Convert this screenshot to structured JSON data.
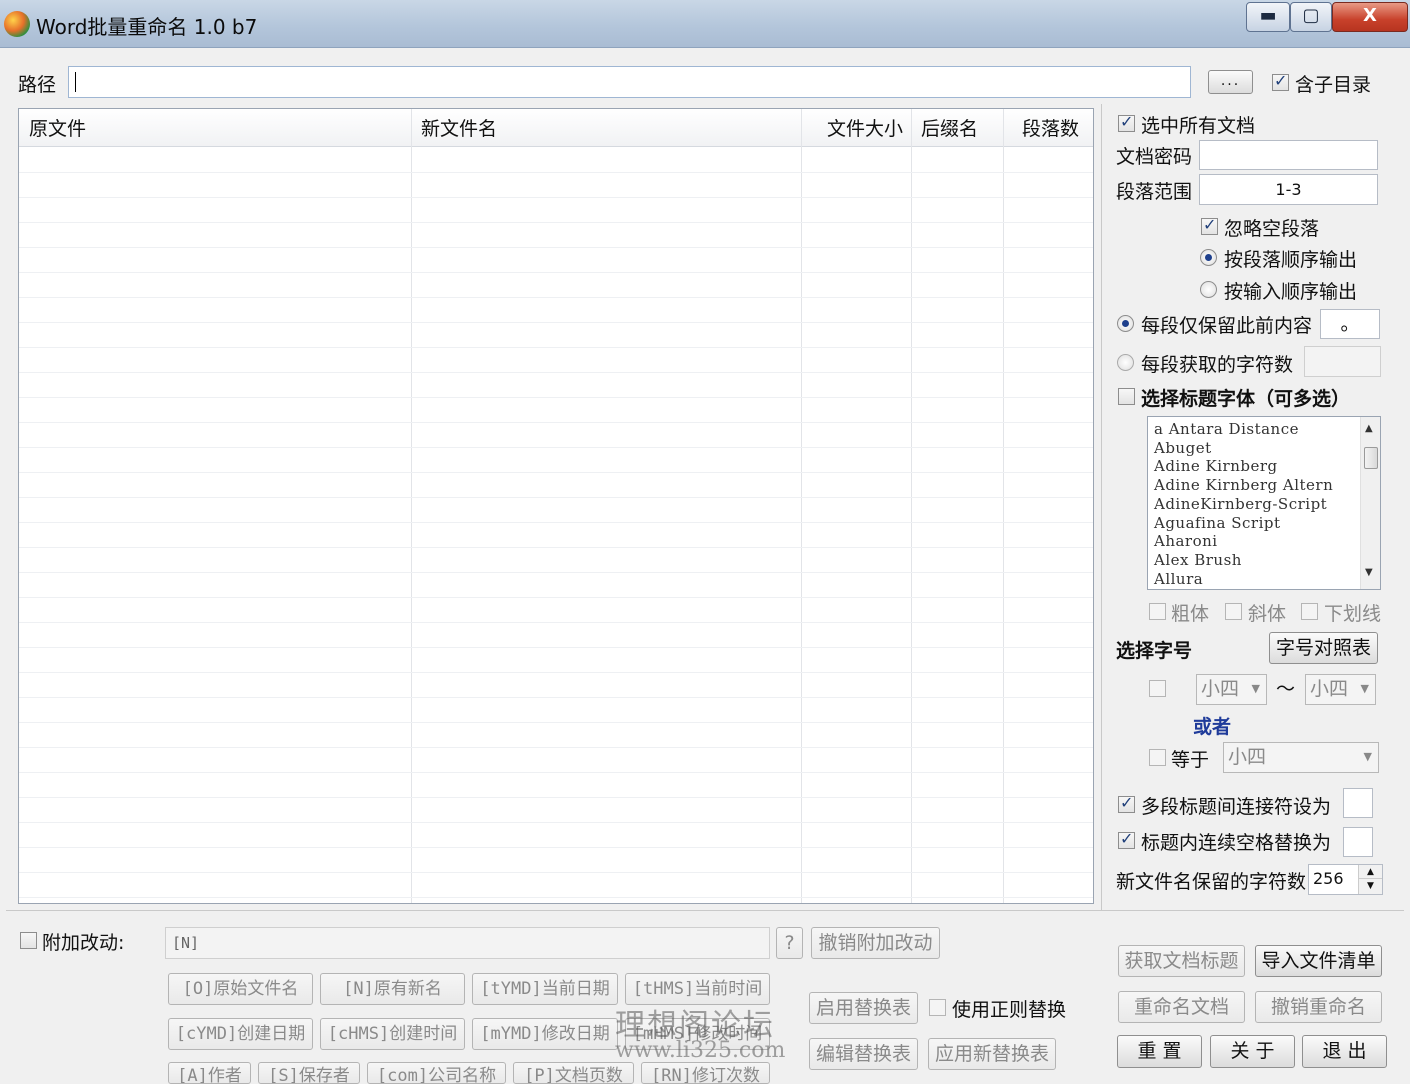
{
  "window": {
    "title": "Word批量重命名 1.0 b7",
    "min_glyph": "▬",
    "max_glyph": "▢",
    "close_glyph": "X"
  },
  "path": {
    "label": "路径",
    "value": "",
    "browse_label": "...",
    "include_subdirs_label": "含子目录",
    "include_subdirs_checked": true
  },
  "grid": {
    "columns": [
      "原文件",
      "新文件名",
      "文件大小",
      "后缀名",
      "段落数"
    ],
    "rows": []
  },
  "options": {
    "select_all_label": "选中所有文档",
    "select_all_checked": true,
    "password_label": "文档密码",
    "password_value": "",
    "range_label": "段落范围",
    "range_value": "1-3",
    "ignore_empty_label": "忽略空段落",
    "ignore_empty_checked": true,
    "order_para_label": "按段落顺序输出",
    "order_input_label": "按输入顺序输出",
    "order_selected": "para",
    "keep_before_label": "每段仅保留此前内容",
    "keep_before_value": "。",
    "char_count_label": "每段获取的字符数",
    "char_count_value": "",
    "mode_selected": "keep_before",
    "heading_font_label": "选择标题字体（可多选）",
    "heading_font_checked": false,
    "fonts": [
      "a Antara Distance",
      "Abuget",
      "Adine Kirnberg",
      "Adine Kirnberg Altern",
      "AdineKirnberg-Script",
      "Aguafina Script",
      "Aharoni",
      "Alex Brush",
      "Allura"
    ],
    "bold_label": "粗体",
    "italic_label": "斜体",
    "underline_label": "下划线",
    "font_size_label": "选择字号",
    "size_table_button": "字号对照表",
    "size_from": "小四",
    "size_to": "小四",
    "size_range_sep": "〜",
    "or_label": "或者",
    "equals_label": "等于",
    "equals_value": "小四",
    "joiner_label": "多段标题间连接符设为",
    "joiner_checked": true,
    "joiner_value": "",
    "space_replace_label": "标题内连续空格替换为",
    "space_replace_checked": true,
    "space_replace_value": "",
    "max_chars_label": "新文件名保留的字符数",
    "max_chars_value": "256"
  },
  "extra": {
    "label": "附加改动:",
    "checked": false,
    "template_value": "[N]",
    "help_button": "?",
    "undo_button": "撤销附加改动",
    "tokens": [
      "[O]原始文件名",
      "[N]原有新名",
      "[tYMD]当前日期",
      "[tHMS]当前时间",
      "[cYMD]创建日期",
      "[cHMS]创建时间",
      "[mYMD]修改日期",
      "[mHMS]修改时间",
      "[A]作者",
      "[S]保存者",
      "[com]公司名称",
      "[P]文档页数",
      "[RN]修订次数"
    ]
  },
  "replace": {
    "enable_button": "启用替换表",
    "regex_label": "使用正则替换",
    "regex_checked": false,
    "edit_button": "编辑替换表",
    "apply_button": "应用新替换表"
  },
  "actions": {
    "get_titles": "获取文档标题",
    "import_list": "导入文件清单",
    "rename": "重命名文档",
    "undo_rename": "撤销重命名",
    "reset": "重 置",
    "about": "关 于",
    "exit": "退 出"
  },
  "watermark": {
    "line1": "理想阁论坛",
    "line2": "www.li325.com"
  }
}
